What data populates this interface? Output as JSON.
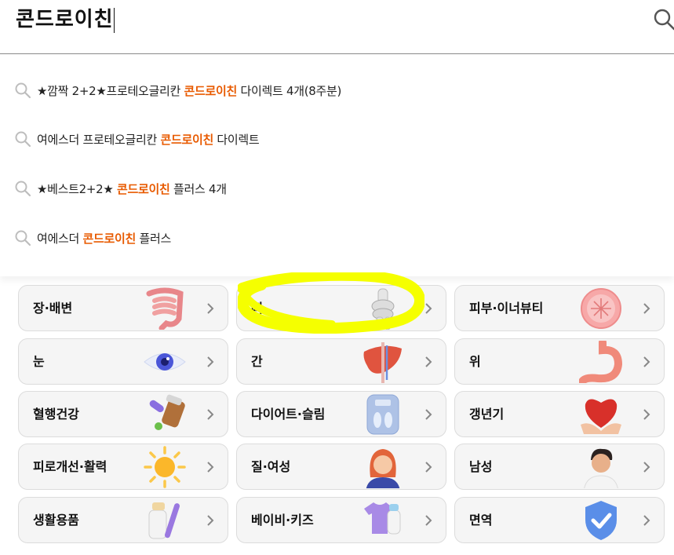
{
  "search": {
    "query": "콘드로이친",
    "icon": "search-icon"
  },
  "suggestions": [
    {
      "prefix": "★깜짝 2+2★프로테오글리칸 ",
      "keyword": "콘드로이친",
      "suffix": " 다이렉트 4개(8주분)"
    },
    {
      "prefix": "여에스더 프로테오글리칸 ",
      "keyword": "콘드로이친",
      "suffix": " 다이렉트"
    },
    {
      "prefix": "★베스트2+2★ ",
      "keyword": "콘드로이친",
      "suffix": " 플러스 4개"
    },
    {
      "prefix": "여에스더 ",
      "keyword": "콘드로이친",
      "suffix": " 플러스"
    }
  ],
  "categories": [
    {
      "label": "장·배변",
      "icon": "intestine-icon"
    },
    {
      "label": "뼈",
      "icon": "bone-joint-icon"
    },
    {
      "label": "피부·이너뷰티",
      "icon": "skin-cell-icon"
    },
    {
      "label": "눈",
      "icon": "eye-icon"
    },
    {
      "label": "간",
      "icon": "liver-icon"
    },
    {
      "label": "위",
      "icon": "stomach-icon"
    },
    {
      "label": "혈행건강",
      "icon": "pill-bottle-icon"
    },
    {
      "label": "다이어트·슬림",
      "icon": "scale-icon"
    },
    {
      "label": "갱년기",
      "icon": "heart-hands-icon"
    },
    {
      "label": "피로개선·활력",
      "icon": "sun-icon"
    },
    {
      "label": "질·여성",
      "icon": "woman-icon"
    },
    {
      "label": "남성",
      "icon": "man-icon"
    },
    {
      "label": "생활용품",
      "icon": "toiletries-icon"
    },
    {
      "label": "베이비·키즈",
      "icon": "baby-clothes-icon"
    },
    {
      "label": "면역",
      "icon": "shield-check-icon"
    }
  ],
  "colors": {
    "keyword": "#e85a00",
    "annotation": "#f5ff00"
  }
}
